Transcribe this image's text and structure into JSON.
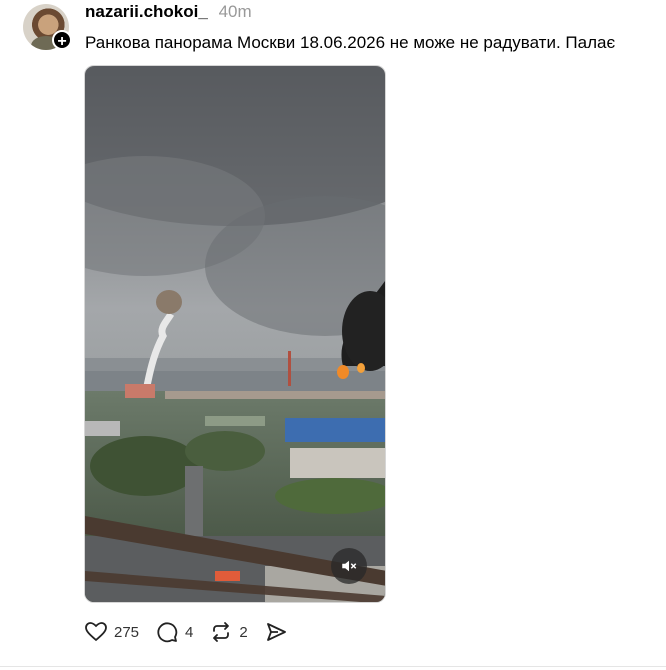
{
  "post": {
    "username": "nazarii.chokoi_",
    "time": "40m",
    "caption": "Ранкова панорама Москви 18.06.2026 не може не радувати. Палає",
    "follow_icon": "plus-icon"
  },
  "media": {
    "type": "video",
    "mute_icon": "muted-speaker-icon"
  },
  "actions": {
    "likes": "275",
    "comments": "4",
    "reposts": "2",
    "like_icon": "heart-icon",
    "comment_icon": "comment-bubble-icon",
    "repost_icon": "repost-icon",
    "share_icon": "send-icon"
  }
}
